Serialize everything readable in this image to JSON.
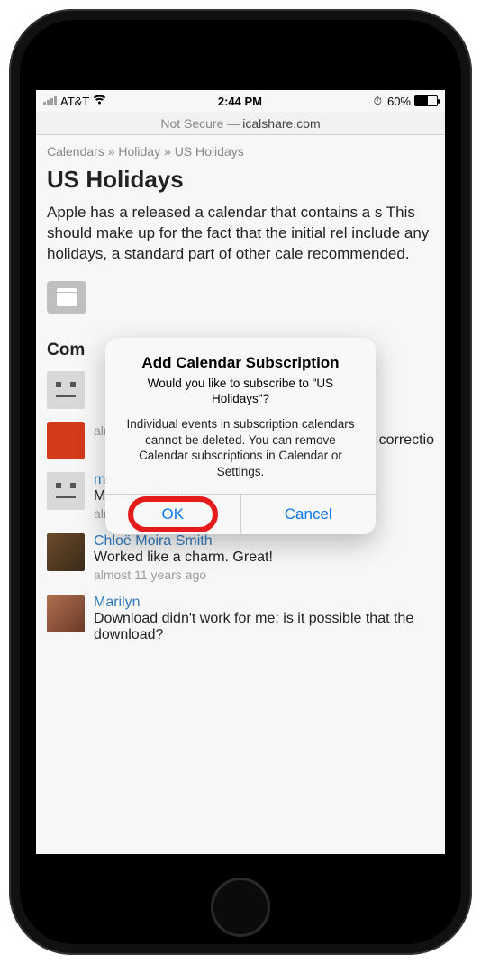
{
  "status_bar": {
    "carrier": "AT&T",
    "time": "2:44 PM",
    "battery_percent": "60%"
  },
  "address_bar": {
    "prefix": "Not Secure —",
    "domain": "icalshare.com"
  },
  "breadcrumb": {
    "a": "Calendars",
    "b": "Holiday",
    "c": "US Holidays",
    "sep": "»"
  },
  "page": {
    "title": "US Holidays",
    "body": "Apple has a released a calendar that contains a s This should make up for the fact that the initial rel include any holidays, a standard part of other cale recommended.",
    "comments_heading": "Com"
  },
  "comments": [
    {
      "name": "",
      "text": "",
      "time": "",
      "avatar": "face"
    },
    {
      "name": "",
      "text": "almost 9 years ago",
      "time": "",
      "avatar": "red",
      "tail": "correctio"
    },
    {
      "name": "micholasgrace",
      "text": "Me Neither!!!!!!!!",
      "time": "almost 11 years ago",
      "avatar": "face"
    },
    {
      "name": "Chloë Moira Smith",
      "text": "Worked like a charm. Great!",
      "time": "almost 11 years ago",
      "avatar": "photo1"
    },
    {
      "name": "Marilyn",
      "text": "Download didn't work for me; is it possible that the download?",
      "time": "",
      "avatar": "photo2"
    }
  ],
  "alert": {
    "title": "Add Calendar Subscription",
    "subtitle": "Would you like to subscribe to \"US Holidays\"?",
    "note": "Individual events in subscription calendars cannot be deleted. You can remove Calendar subscriptions in Calendar or Settings.",
    "ok": "OK",
    "cancel": "Cancel"
  }
}
